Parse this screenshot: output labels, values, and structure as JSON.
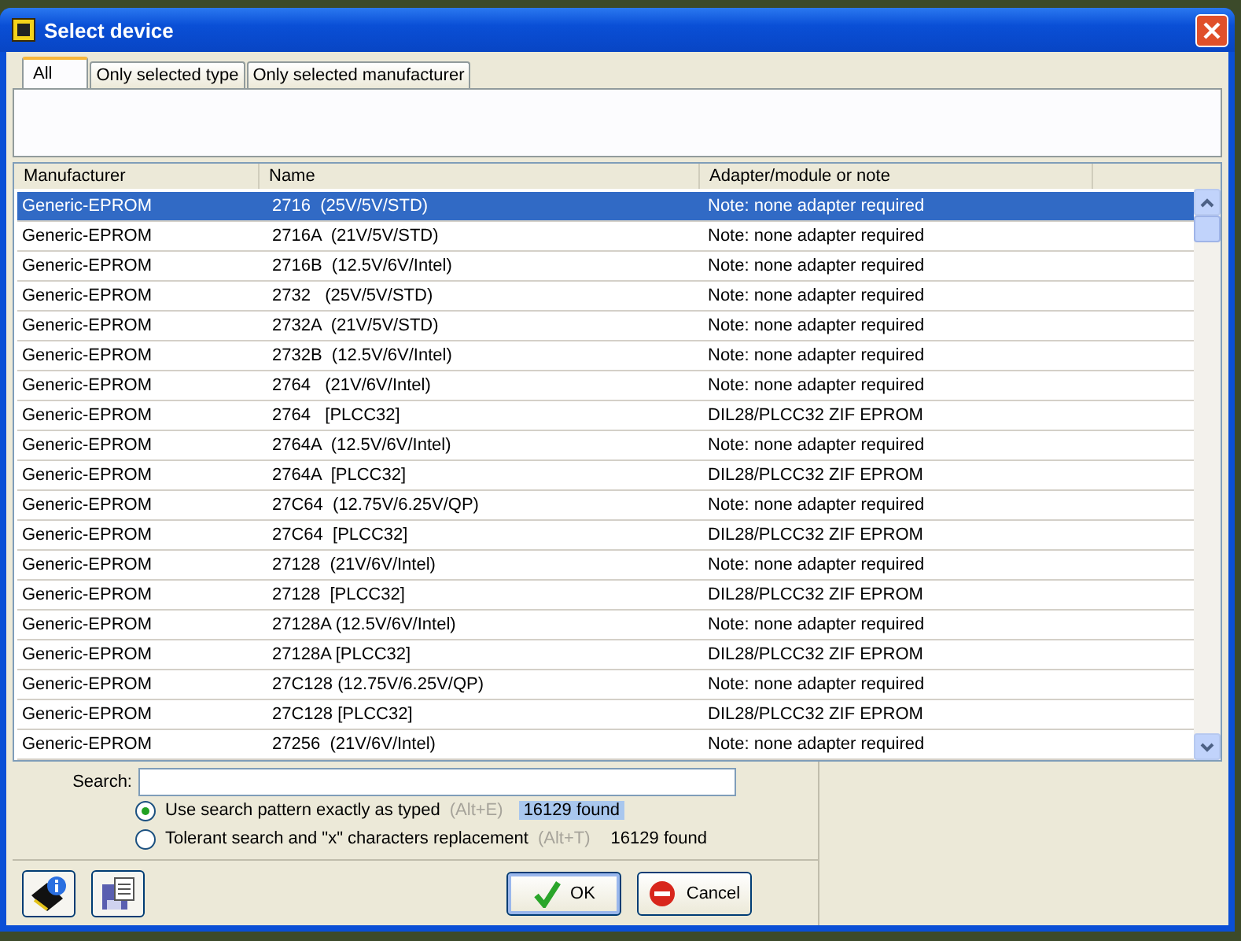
{
  "window": {
    "title": "Select device"
  },
  "tabs": [
    {
      "label": "All",
      "selected": true
    },
    {
      "label": "Only selected type",
      "selected": false
    },
    {
      "label": "Only selected manufacturer",
      "selected": false
    }
  ],
  "table": {
    "columns": [
      "Manufacturer",
      "Name",
      "Adapter/module or note"
    ],
    "rows": [
      {
        "manufacturer": "Generic-EPROM",
        "name": "2716  (25V/5V/STD)",
        "note": "Note: none adapter required",
        "selected": true
      },
      {
        "manufacturer": "Generic-EPROM",
        "name": "2716A  (21V/5V/STD)",
        "note": "Note: none adapter required",
        "selected": false
      },
      {
        "manufacturer": "Generic-EPROM",
        "name": "2716B  (12.5V/6V/Intel)",
        "note": "Note: none adapter required",
        "selected": false
      },
      {
        "manufacturer": "Generic-EPROM",
        "name": "2732   (25V/5V/STD)",
        "note": "Note: none adapter required",
        "selected": false
      },
      {
        "manufacturer": "Generic-EPROM",
        "name": "2732A  (21V/5V/STD)",
        "note": "Note: none adapter required",
        "selected": false
      },
      {
        "manufacturer": "Generic-EPROM",
        "name": "2732B  (12.5V/6V/Intel)",
        "note": "Note: none adapter required",
        "selected": false
      },
      {
        "manufacturer": "Generic-EPROM",
        "name": "2764   (21V/6V/Intel)",
        "note": "Note: none adapter required",
        "selected": false
      },
      {
        "manufacturer": "Generic-EPROM",
        "name": "2764   [PLCC32]",
        "note": "DIL28/PLCC32 ZIF EPROM",
        "selected": false
      },
      {
        "manufacturer": "Generic-EPROM",
        "name": "2764A  (12.5V/6V/Intel)",
        "note": "Note: none adapter required",
        "selected": false
      },
      {
        "manufacturer": "Generic-EPROM",
        "name": "2764A  [PLCC32]",
        "note": "DIL28/PLCC32 ZIF EPROM",
        "selected": false
      },
      {
        "manufacturer": "Generic-EPROM",
        "name": "27C64  (12.75V/6.25V/QP)",
        "note": "Note: none adapter required",
        "selected": false
      },
      {
        "manufacturer": "Generic-EPROM",
        "name": "27C64  [PLCC32]",
        "note": "DIL28/PLCC32 ZIF EPROM",
        "selected": false
      },
      {
        "manufacturer": "Generic-EPROM",
        "name": "27128  (21V/6V/Intel)",
        "note": "Note: none adapter required",
        "selected": false
      },
      {
        "manufacturer": "Generic-EPROM",
        "name": "27128  [PLCC32]",
        "note": "DIL28/PLCC32 ZIF EPROM",
        "selected": false
      },
      {
        "manufacturer": "Generic-EPROM",
        "name": "27128A (12.5V/6V/Intel)",
        "note": "Note: none adapter required",
        "selected": false
      },
      {
        "manufacturer": "Generic-EPROM",
        "name": "27128A [PLCC32]",
        "note": "DIL28/PLCC32 ZIF EPROM",
        "selected": false
      },
      {
        "manufacturer": "Generic-EPROM",
        "name": "27C128 (12.75V/6.25V/QP)",
        "note": "Note: none adapter required",
        "selected": false
      },
      {
        "manufacturer": "Generic-EPROM",
        "name": "27C128 [PLCC32]",
        "note": "DIL28/PLCC32 ZIF EPROM",
        "selected": false
      },
      {
        "manufacturer": "Generic-EPROM",
        "name": "27256  (21V/6V/Intel)",
        "note": "Note: none adapter required",
        "selected": false
      }
    ]
  },
  "search": {
    "label": "Search:"
  },
  "options": [
    {
      "label": "Use search pattern exactly as typed",
      "shortcut": "(Alt+E)",
      "count": "16129 found",
      "selected": true
    },
    {
      "label": "Tolerant search and \"x\" characters replacement",
      "shortcut": "(Alt+T)",
      "count": "16129 found",
      "selected": false
    }
  ],
  "buttons": [
    {
      "kind": "ok",
      "label": "OK"
    },
    {
      "kind": "cancel",
      "label": "Cancel"
    }
  ]
}
